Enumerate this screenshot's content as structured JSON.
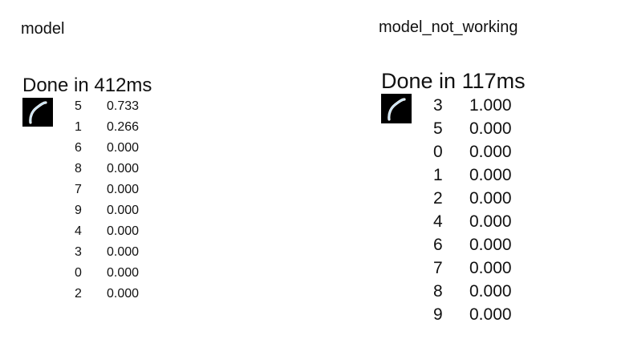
{
  "left_panel": {
    "title": "model",
    "status": "Done in 412ms",
    "predictions": [
      {
        "label": "5",
        "prob": "0.733"
      },
      {
        "label": "1",
        "prob": "0.266"
      },
      {
        "label": "6",
        "prob": "0.000"
      },
      {
        "label": "8",
        "prob": "0.000"
      },
      {
        "label": "7",
        "prob": "0.000"
      },
      {
        "label": "9",
        "prob": "0.000"
      },
      {
        "label": "4",
        "prob": "0.000"
      },
      {
        "label": "3",
        "prob": "0.000"
      },
      {
        "label": "0",
        "prob": "0.000"
      },
      {
        "label": "2",
        "prob": "0.000"
      }
    ]
  },
  "right_panel": {
    "title": "model_not_working",
    "status": "Done in 117ms",
    "predictions": [
      {
        "label": "3",
        "prob": "1.000"
      },
      {
        "label": "5",
        "prob": "0.000"
      },
      {
        "label": "0",
        "prob": "0.000"
      },
      {
        "label": "1",
        "prob": "0.000"
      },
      {
        "label": "2",
        "prob": "0.000"
      },
      {
        "label": "4",
        "prob": "0.000"
      },
      {
        "label": "6",
        "prob": "0.000"
      },
      {
        "label": "7",
        "prob": "0.000"
      },
      {
        "label": "8",
        "prob": "0.000"
      },
      {
        "label": "9",
        "prob": "0.000"
      }
    ]
  }
}
